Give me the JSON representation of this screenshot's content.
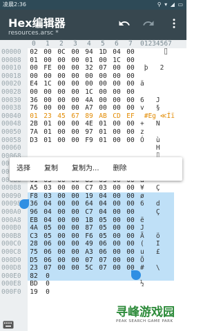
{
  "statusbar": {
    "time": "凌晨2:36",
    "icons": "⚲ ▾ ◢ ▭"
  },
  "appbar": {
    "title": "Hex编辑器",
    "subtitle": "resources.arsc *"
  },
  "header": {
    "cols": [
      "0",
      "1",
      "2",
      "3",
      "4",
      "5",
      "6",
      "7"
    ],
    "ascii": "01234567"
  },
  "rows": [
    {
      "addr": "00000",
      "bytes": [
        "02",
        "00",
        "0C",
        "00",
        "94",
        "1D",
        "04",
        "00"
      ],
      "ascii": "      ⌷ "
    },
    {
      "addr": "00008",
      "bytes": [
        "01",
        "00",
        "00",
        "00",
        "01",
        "00",
        "1C",
        "00"
      ],
      "ascii": "        "
    },
    {
      "addr": "00010",
      "bytes": [
        "00",
        "FE",
        "00",
        "00",
        "32",
        "07",
        "00",
        "00"
      ],
      "ascii": " þ   2  "
    },
    {
      "addr": "00018",
      "bytes": [
        "00",
        "00",
        "00",
        "00",
        "00",
        "00",
        "00",
        "00"
      ],
      "ascii": "        "
    },
    {
      "addr": "00020",
      "bytes": [
        "E4",
        "1C",
        "00",
        "00",
        "00",
        "00",
        "00",
        "00"
      ],
      "ascii": "ä       "
    },
    {
      "addr": "00028",
      "bytes": [
        "00",
        "00",
        "00",
        "00",
        "1C",
        "00",
        "00",
        "00"
      ],
      "ascii": "        "
    },
    {
      "addr": "00030",
      "bytes": [
        "36",
        "00",
        "00",
        "00",
        "4A",
        "00",
        "00",
        "00"
      ],
      "ascii": "6   J   "
    },
    {
      "addr": "00038",
      "bytes": [
        "76",
        "00",
        "00",
        "00",
        "A7",
        "00",
        "00",
        "00"
      ],
      "ascii": "v   §   "
    },
    {
      "addr": "00040",
      "bytes": [
        "01",
        "23",
        "45",
        "67",
        "89",
        "AB",
        "CD",
        "EF"
      ],
      "ascii": " #Eg ≪Íï",
      "hl": true
    },
    {
      "addr": "00048",
      "bytes": [
        "2B",
        "01",
        "00",
        "00",
        "4E",
        "01",
        "00",
        "00"
      ],
      "ascii": "+   N   "
    },
    {
      "addr": "00050",
      "bytes": [
        "7A",
        "01",
        "00",
        "00",
        "97",
        "01",
        "00",
        "00"
      ],
      "ascii": "z       "
    },
    {
      "addr": "00058",
      "bytes": [
        "D3",
        "01",
        "00",
        "00",
        "F9",
        "01",
        "00",
        "00"
      ],
      "ascii": "Ó   ù   "
    },
    {
      "addr": "00060",
      "bytes": [
        "",
        "",
        "",
        "",
        "",
        "",
        "",
        ""
      ],
      "ascii": "    H   "
    },
    {
      "addr": "00068",
      "bytes": [
        "",
        "",
        "",
        "",
        "",
        "",
        "",
        ""
      ],
      "ascii": "    ⌷   "
    },
    {
      "addr": "00070",
      "bytes": [
        "",
        "",
        "",
        "",
        "",
        "",
        "",
        ""
      ],
      "ascii": "    é   "
    },
    {
      "addr": "00078",
      "bytes": [
        "18",
        "03",
        "00",
        "00",
        "42",
        "03",
        "00",
        "00"
      ],
      "ascii": "    B   "
    },
    {
      "addr": "00080",
      "bytes": [
        "61",
        "03",
        "00",
        "00",
        "85",
        "03",
        "00",
        "00"
      ],
      "ascii": "a       "
    },
    {
      "addr": "00088",
      "bytes": [
        "A5",
        "03",
        "00",
        "00",
        "C7",
        "03",
        "00",
        "00"
      ],
      "ascii": "¥   Ç   "
    },
    {
      "addr": "00090",
      "bytes": [
        "F8",
        "03",
        "00",
        "00",
        "19",
        "04",
        "00",
        "00"
      ],
      "ascii": "ø       "
    },
    {
      "addr": "00098",
      "bytes": [
        "36",
        "04",
        "00",
        "00",
        "64",
        "04",
        "00",
        "00"
      ],
      "ascii": "6   d   "
    },
    {
      "addr": "000A0",
      "bytes": [
        "96",
        "04",
        "00",
        "00",
        "C7",
        "04",
        "00",
        "00"
      ],
      "ascii": "    Ç   "
    },
    {
      "addr": "000A8",
      "bytes": [
        "EB",
        "04",
        "00",
        "00",
        "1B",
        "05",
        "00",
        "00"
      ],
      "ascii": "ë       "
    },
    {
      "addr": "000B0",
      "bytes": [
        "4A",
        "05",
        "00",
        "00",
        "87",
        "05",
        "00",
        "00"
      ],
      "ascii": "J       "
    },
    {
      "addr": "000B8",
      "bytes": [
        "C3",
        "05",
        "00",
        "00",
        "F6",
        "05",
        "00",
        "00"
      ],
      "ascii": "Ã   ö   "
    },
    {
      "addr": "000C0",
      "bytes": [
        "28",
        "06",
        "00",
        "00",
        "49",
        "06",
        "00",
        "00"
      ],
      "ascii": "(   I   "
    },
    {
      "addr": "000C8",
      "bytes": [
        "75",
        "06",
        "00",
        "00",
        "A3",
        "06",
        "00",
        "00"
      ],
      "ascii": "u   £   "
    },
    {
      "addr": "000D0",
      "bytes": [
        "D5",
        "06",
        "00",
        "00",
        "07",
        "07",
        "00",
        "00"
      ],
      "ascii": "Õ       "
    },
    {
      "addr": "000D8",
      "bytes": [
        "23",
        "07",
        "00",
        "00",
        "5C",
        "07",
        "00",
        "00"
      ],
      "ascii": "#   \\   "
    },
    {
      "addr": "000E0",
      "bytes": [
        "82",
        "0",
        "",
        "",
        "",
        "",
        "",
        ""
      ],
      "ascii": "        "
    },
    {
      "addr": "000E8",
      "bytes": [
        "BD",
        "0",
        "",
        "",
        "",
        "",
        "",
        ""
      ],
      "ascii": "½       "
    },
    {
      "addr": "000F0",
      "bytes": [
        "19",
        "0",
        "",
        "",
        "",
        "",
        "",
        ""
      ],
      "ascii": "        "
    }
  ],
  "popup": {
    "items": [
      "选择",
      "复制",
      "复制为...",
      "删除"
    ]
  },
  "watermark": {
    "title": "寻峰游戏园",
    "sub": "PEAK SEARCH GAME PARK"
  },
  "colors": {
    "appbar": "#37474f",
    "statusbar": "#2e4a57",
    "highlight": "#e28a00",
    "selection": "#bfe0f7",
    "cursor": "#2f8fe3",
    "watermark": "#2d8b3a"
  }
}
